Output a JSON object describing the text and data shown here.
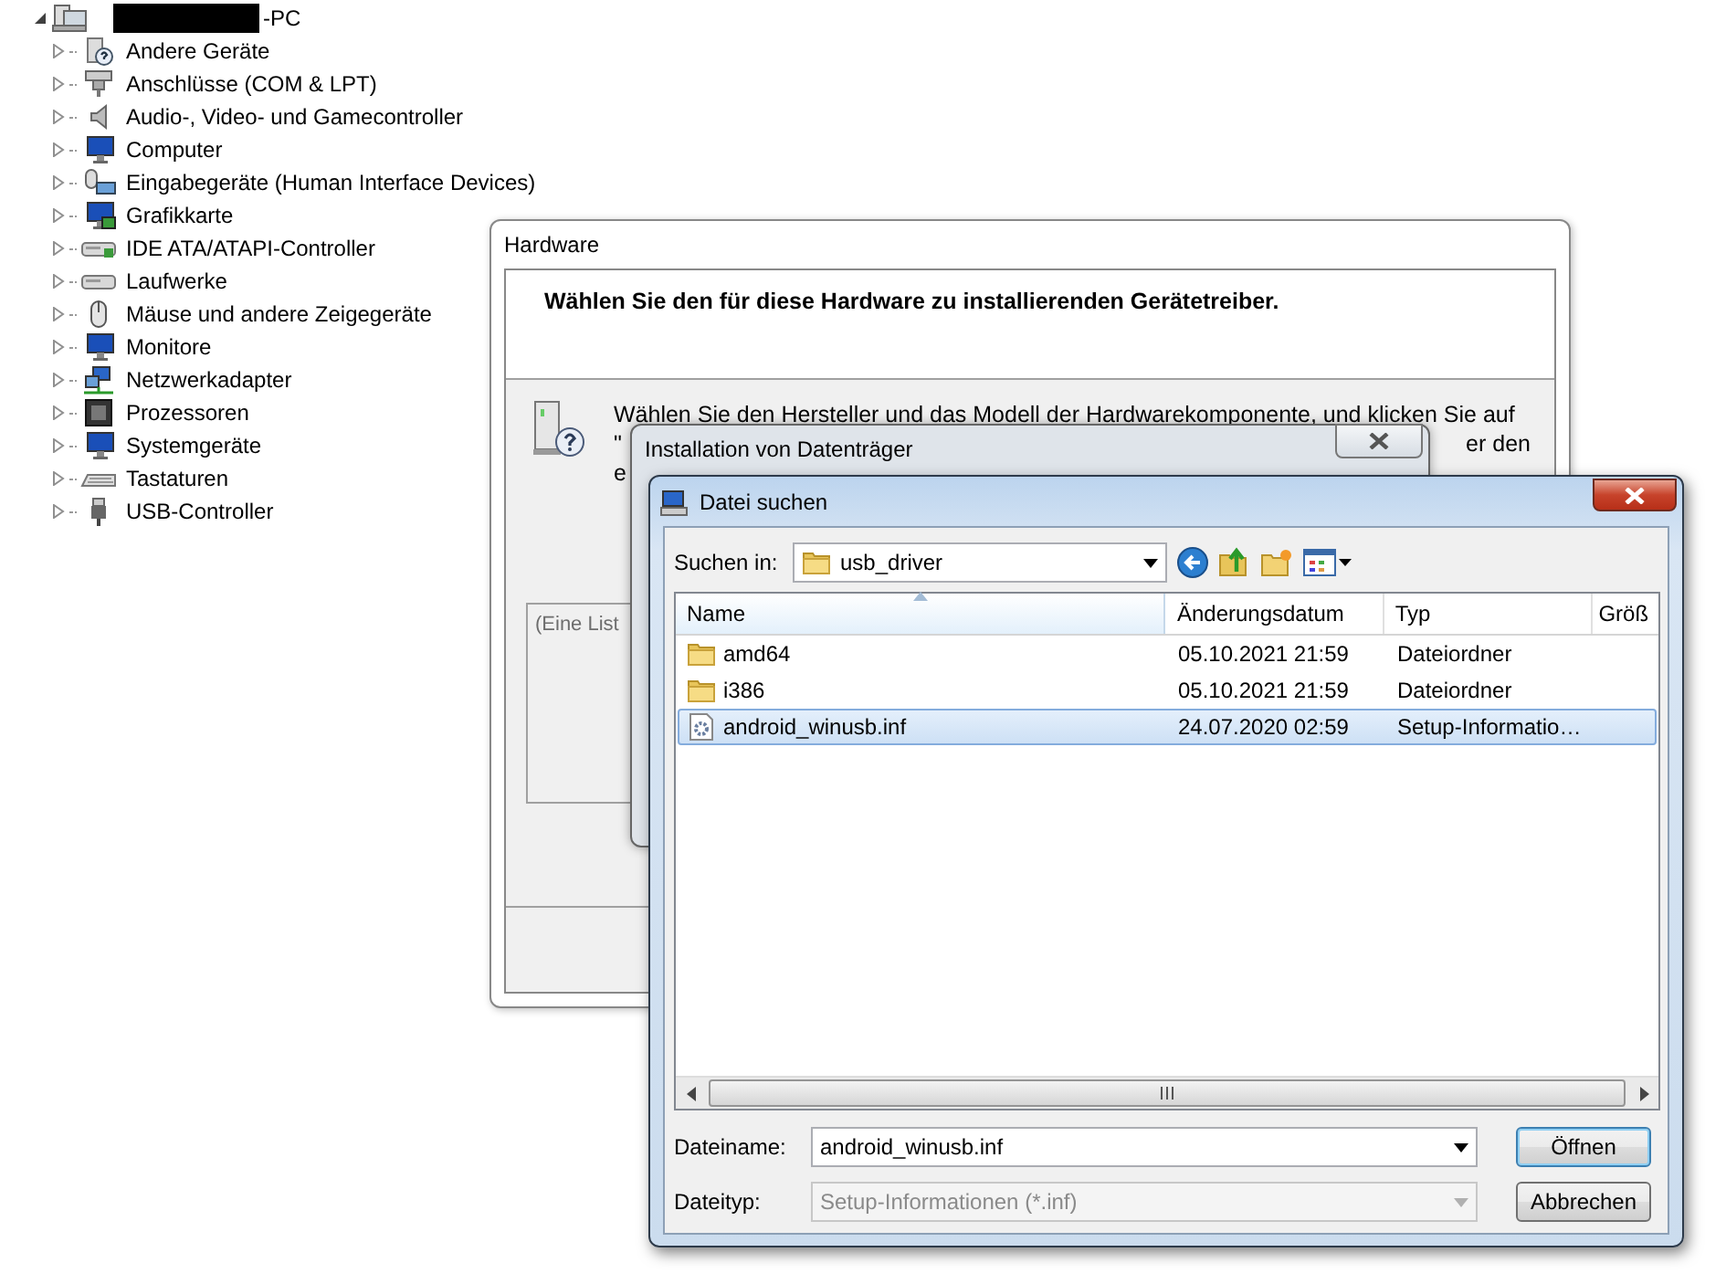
{
  "tree": {
    "root": {
      "label": "-PC",
      "expanded": true,
      "redacted": true
    },
    "items": [
      {
        "label": "Andere Geräte",
        "expanded": false
      },
      {
        "label": "Anschlüsse (COM & LPT)",
        "expanded": false
      },
      {
        "label": "Audio-, Video- und Gamecontroller",
        "expanded": false
      },
      {
        "label": "Computer",
        "expanded": false
      },
      {
        "label": "Eingabegeräte (Human Interface Devices)",
        "expanded": false
      },
      {
        "label": "Grafikkarte",
        "expanded": false
      },
      {
        "label": "IDE ATA/ATAPI-Controller",
        "expanded": false
      },
      {
        "label": "Laufwerke",
        "expanded": false
      },
      {
        "label": "Mäuse und andere Zeigegeräte",
        "expanded": false
      },
      {
        "label": "Monitore",
        "expanded": false
      },
      {
        "label": "Netzwerkadapter",
        "expanded": false
      },
      {
        "label": "Prozessoren",
        "expanded": false
      },
      {
        "label": "Systemgeräte",
        "expanded": false
      },
      {
        "label": "Tastaturen",
        "expanded": false
      },
      {
        "label": "USB-Controller",
        "expanded": false
      }
    ]
  },
  "hardware_dialog": {
    "title": "Hardware",
    "heading": "Wählen Sie den für diese Hardware zu installierenden Gerätetreiber.",
    "instruction_lines": [
      {
        "left": "Wählen Sie den Hersteller und das Modell der Hardwarekomponente, und klicken Sie auf"
      },
      {
        "left": "\"",
        "right": "er den"
      },
      {
        "left": "e"
      }
    ],
    "list_placeholder": "(Eine List"
  },
  "install_dialog": {
    "title": "Installation von Datenträger"
  },
  "file_dialog": {
    "title": "Datei suchen",
    "look_in_label": "Suchen in:",
    "look_in_value": "usb_driver",
    "columns": [
      "Name",
      "Änderungsdatum",
      "Typ",
      "Größ"
    ],
    "rows": [
      {
        "kind": "folder",
        "name": "amd64",
        "date": "05.10.2021 21:59",
        "type": "Dateiordner",
        "selected": false
      },
      {
        "kind": "folder",
        "name": "i386",
        "date": "05.10.2021 21:59",
        "type": "Dateiordner",
        "selected": false
      },
      {
        "kind": "file",
        "name": "android_winusb.inf",
        "date": "24.07.2020 02:59",
        "type": "Setup-Informatio…",
        "selected": true
      }
    ],
    "filename_label": "Dateiname:",
    "filename_value": "android_winusb.inf",
    "filetype_label": "Dateityp:",
    "filetype_value": "Setup-Informationen (*.inf)",
    "filetype_disabled": true,
    "buttons": [
      {
        "label": "Öffnen",
        "default": true
      },
      {
        "label": "Abbrechen",
        "default": false
      }
    ]
  }
}
